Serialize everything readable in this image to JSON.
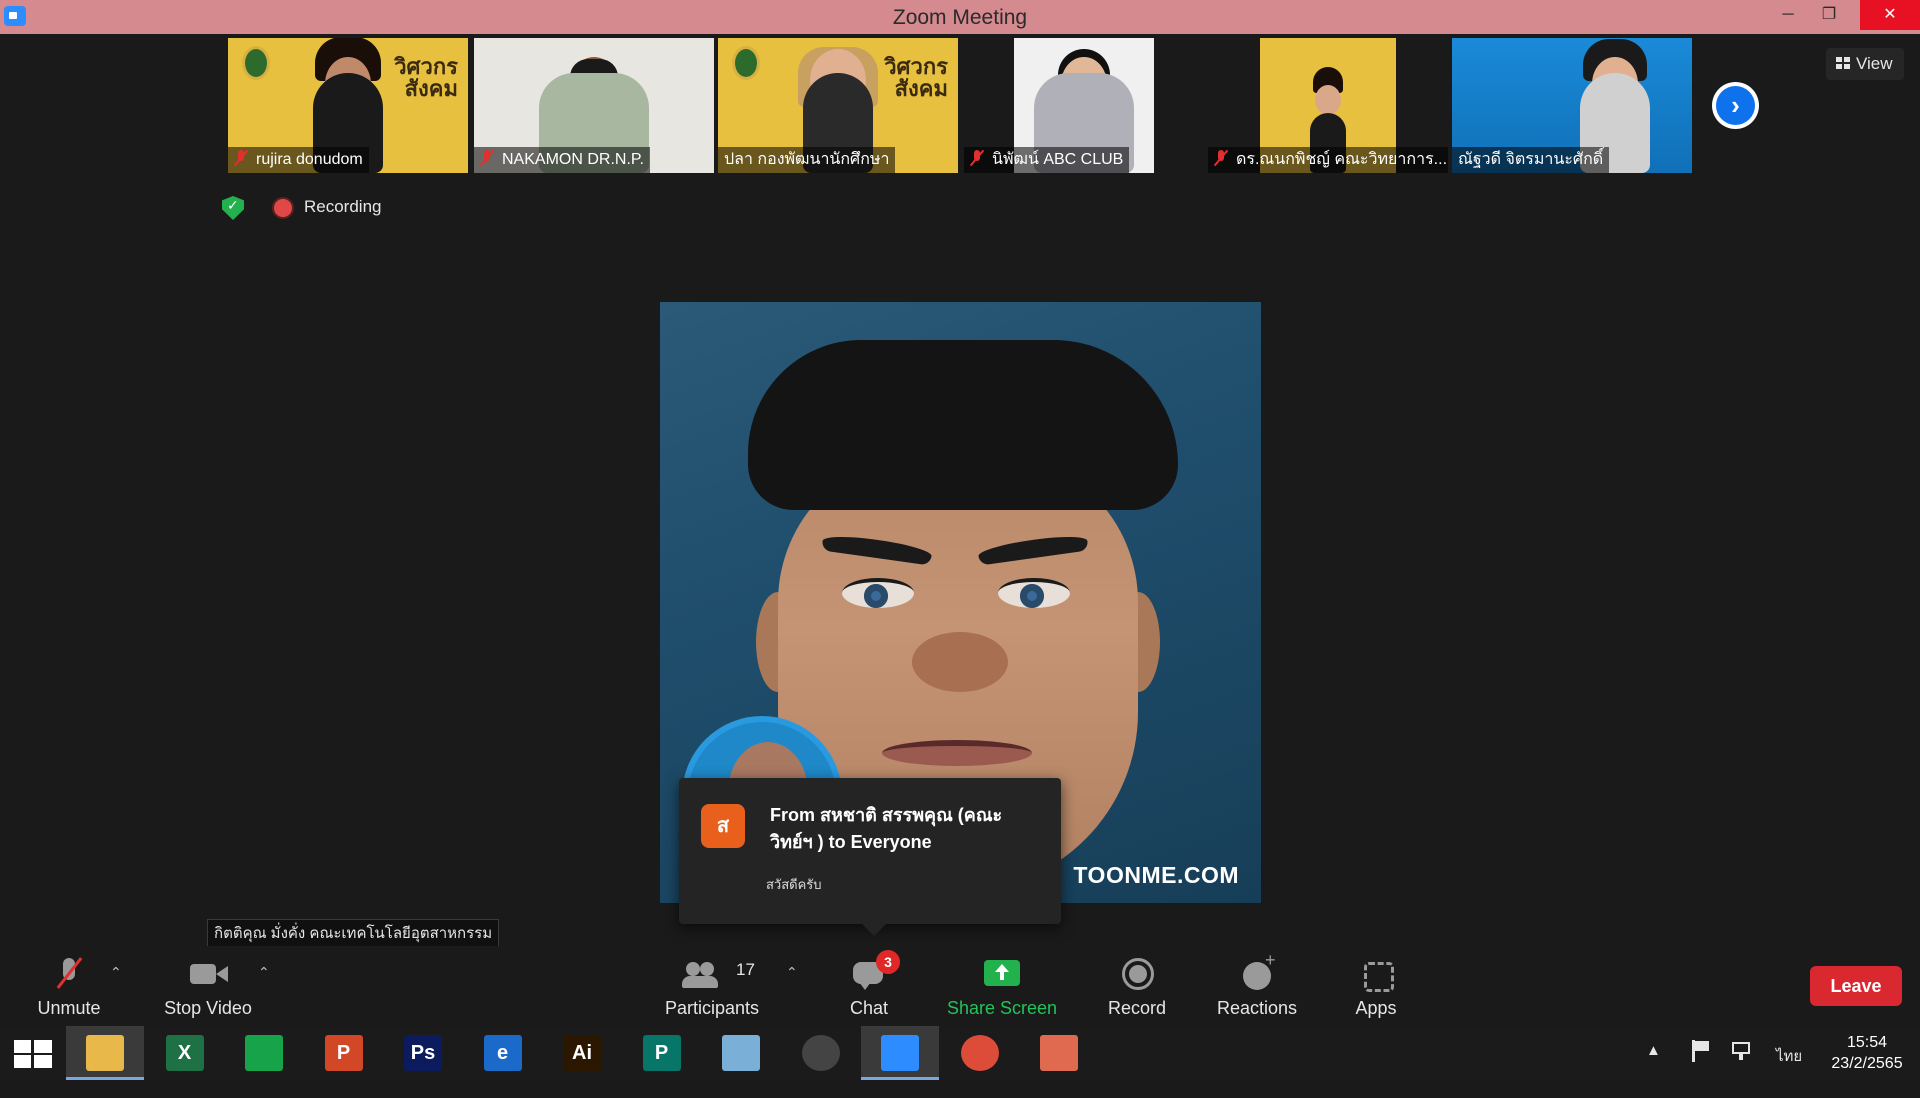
{
  "window": {
    "title": "Zoom Meeting",
    "minimize": "─",
    "maximize": "❐",
    "close": "✕"
  },
  "thumbnails": [
    {
      "name": "rujira donudom",
      "muted": true
    },
    {
      "name": "NAKAMON DR.N.P.",
      "muted": true
    },
    {
      "name": "ปลา กองพัฒนานักศึกษา",
      "muted": false
    },
    {
      "name": "นิพัฒน์ ABC CLUB",
      "muted": true
    },
    {
      "name": "ดร.ณนกพิชญ์ คณะวิทยาการ...",
      "muted": true
    },
    {
      "name": "ณัฐวดี จิตรมานะศักดิ์",
      "muted": false
    }
  ],
  "banner_text": "วิศวกร\nสังคม",
  "next_page_glyph": "›",
  "view_button": {
    "label": "View"
  },
  "recording": {
    "label": "Recording"
  },
  "main_video": {
    "watermark": "TOONME.COM"
  },
  "chat_notification": {
    "avatar_initial": "ส",
    "from": "From สหชาติ สรรพคุณ (คณะวิทย์ฯ ) to Everyone",
    "message": "สวัสดีครับ"
  },
  "tooltip": "กิตติคุณ มั่งคั่ง คณะเทคโนโลยีอุตสาหกรรม",
  "toolbar": {
    "unmute": "Unmute",
    "stop_video": "Stop Video",
    "participants": "Participants",
    "participant_count": "17",
    "chat": "Chat",
    "chat_badge": "3",
    "share_screen": "Share Screen",
    "record": "Record",
    "reactions": "Reactions",
    "apps": "Apps",
    "leave": "Leave",
    "caret": "⌃"
  },
  "taskbar": {
    "apps": [
      {
        "name": "file-explorer",
        "glyph": "",
        "color": "#e8b84a"
      },
      {
        "name": "excel",
        "glyph": "X",
        "color": "#1e7145"
      },
      {
        "name": "store",
        "glyph": "",
        "color": "#16a34a"
      },
      {
        "name": "powerpoint",
        "glyph": "P",
        "color": "#d24726"
      },
      {
        "name": "photoshop",
        "glyph": "Ps",
        "color": "#0b1b5e"
      },
      {
        "name": "internet-explorer",
        "glyph": "e",
        "color": "#1b6ac9"
      },
      {
        "name": "illustrator",
        "glyph": "Ai",
        "color": "#2b1700"
      },
      {
        "name": "publisher",
        "glyph": "P",
        "color": "#077568"
      },
      {
        "name": "eraser-app",
        "glyph": "",
        "color": "#7ab0d8"
      },
      {
        "name": "photoscape",
        "glyph": "",
        "color": "#444444"
      },
      {
        "name": "zoom",
        "glyph": "",
        "color": "#2d8cff"
      },
      {
        "name": "chrome",
        "glyph": "",
        "color": "#dd4b39"
      },
      {
        "name": "photos",
        "glyph": "",
        "color": "#e06a50"
      }
    ],
    "tray_chevron": "▲",
    "language": "ไทย",
    "time": "15:54",
    "date": "23/2/2565"
  }
}
